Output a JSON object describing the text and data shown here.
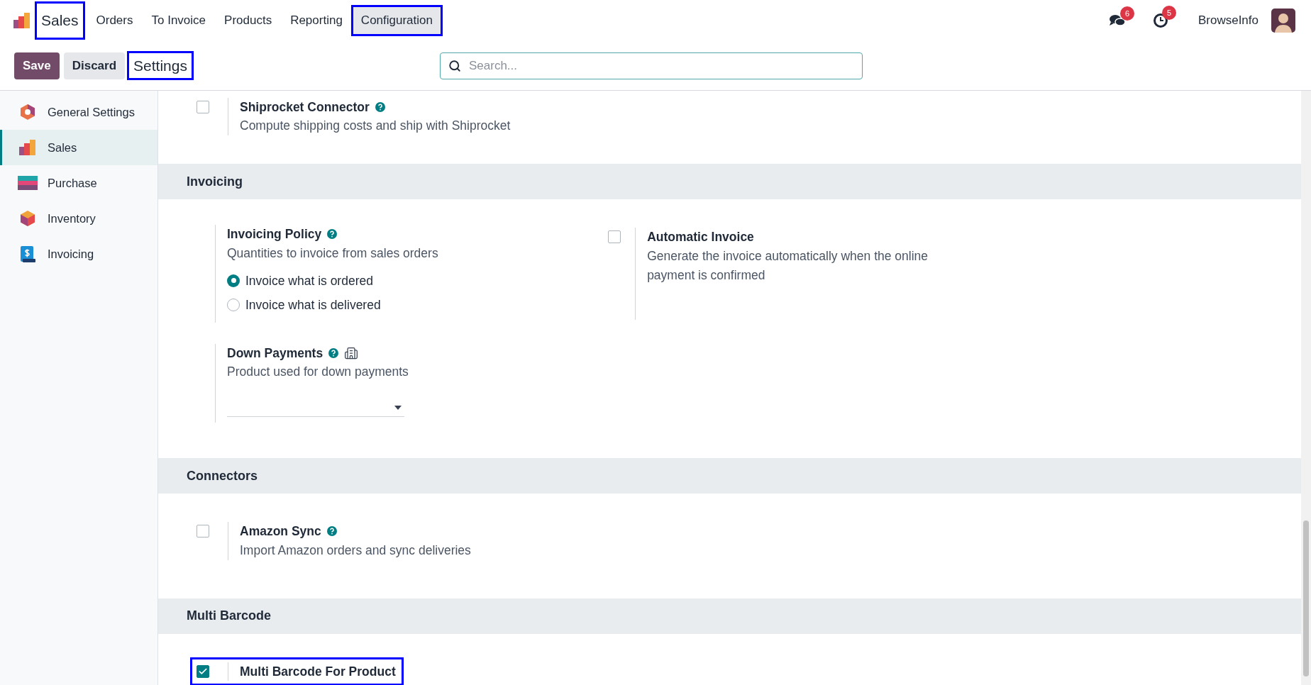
{
  "navbar": {
    "app": {
      "label": "Sales",
      "highlighted": true
    },
    "menu": [
      {
        "label": "Orders",
        "selected": false,
        "highlighted": false
      },
      {
        "label": "To Invoice",
        "selected": false,
        "highlighted": false
      },
      {
        "label": "Products",
        "selected": false,
        "highlighted": false
      },
      {
        "label": "Reporting",
        "selected": false,
        "highlighted": false
      },
      {
        "label": "Configuration",
        "selected": true,
        "highlighted": true
      }
    ],
    "messages_count": "6",
    "activities_count": "5",
    "user": "BrowseInfo"
  },
  "control_panel": {
    "buttons": [
      {
        "label": "Save",
        "kind": "primary"
      },
      {
        "label": "Discard",
        "kind": "secondary"
      }
    ],
    "title": {
      "label": "Settings",
      "highlighted": true
    },
    "search": {
      "placeholder": "Search..."
    }
  },
  "sidebar": {
    "items": [
      {
        "label": "General Settings",
        "kind": "general",
        "selected": false
      },
      {
        "label": "Sales",
        "kind": "sales",
        "selected": true
      },
      {
        "label": "Purchase",
        "kind": "purchase",
        "selected": false
      },
      {
        "label": "Inventory",
        "kind": "inventory",
        "selected": false
      },
      {
        "label": "Invoicing",
        "kind": "invoicing",
        "selected": false
      }
    ]
  },
  "sections": [
    {
      "settings": [
        {
          "kind": "checkbox",
          "title": "Shiprocket Connector",
          "help": true,
          "description": "Compute shipping costs and ship with Shiprocket",
          "checked": false,
          "highlighted": false
        }
      ]
    },
    {
      "title": "Invoicing",
      "settings": [
        {
          "kind": "radio",
          "title": "Invoicing Policy",
          "help": true,
          "description": "Quantities to invoice from sales orders",
          "options": [
            {
              "label": "Invoice what is ordered",
              "selected": true
            },
            {
              "label": "Invoice what is delivered",
              "selected": false
            }
          ]
        },
        {
          "kind": "checkbox",
          "title": "Automatic Invoice",
          "help": false,
          "description": "Generate the invoice automatically when the online payment is confirmed",
          "checked": false,
          "highlighted": false
        },
        {
          "kind": "select",
          "title": "Down Payments",
          "help": true,
          "description": "Product used for down payments"
        }
      ]
    },
    {
      "title": "Connectors",
      "settings": [
        {
          "kind": "checkbox",
          "title": "Amazon Sync",
          "help": true,
          "description": "Import Amazon orders and sync deliveries",
          "checked": false,
          "highlighted": false
        }
      ]
    },
    {
      "title": "Multi Barcode",
      "settings": [
        {
          "kind": "checkbox",
          "title": "Multi Barcode For Product",
          "help": false,
          "checked": true,
          "highlighted": true
        }
      ]
    }
  ]
}
